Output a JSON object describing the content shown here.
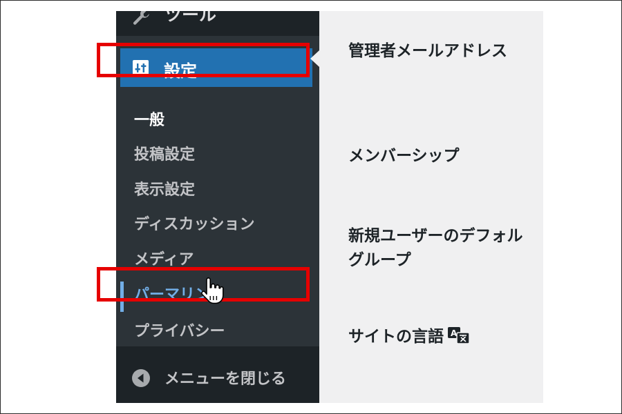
{
  "sidebar": {
    "tools": {
      "label": "ツール",
      "icon": "wrench-icon"
    },
    "settings": {
      "label": "設定",
      "icon": "settings-sliders-icon",
      "active": true
    },
    "submenu": [
      {
        "label": "一般",
        "state": "current"
      },
      {
        "label": "投稿設定",
        "state": "normal"
      },
      {
        "label": "表示設定",
        "state": "normal"
      },
      {
        "label": "ディスカッション",
        "state": "normal"
      },
      {
        "label": "メディア",
        "state": "normal"
      },
      {
        "label": "パーマリンク",
        "state": "hover"
      },
      {
        "label": "プライバシー",
        "state": "normal"
      }
    ],
    "collapse": {
      "label": "メニューを閉じる",
      "icon": "collapse-arrow-icon"
    }
  },
  "main": {
    "fields": [
      {
        "label": "管理者メールアドレス"
      },
      {
        "label": "メンバーシップ"
      },
      {
        "label_line1": "新規ユーザーのデフォル",
        "label_line2": "グループ"
      },
      {
        "label": "サイトの言語",
        "icon": "translate-icon"
      }
    ]
  },
  "colors": {
    "sidebar_bg": "#2c3338",
    "sidebar_dark": "#1d2327",
    "active_blue": "#2271b1",
    "hover_blue": "#72aee6",
    "main_bg": "#f0f0f1",
    "highlight_red": "#e60000"
  }
}
